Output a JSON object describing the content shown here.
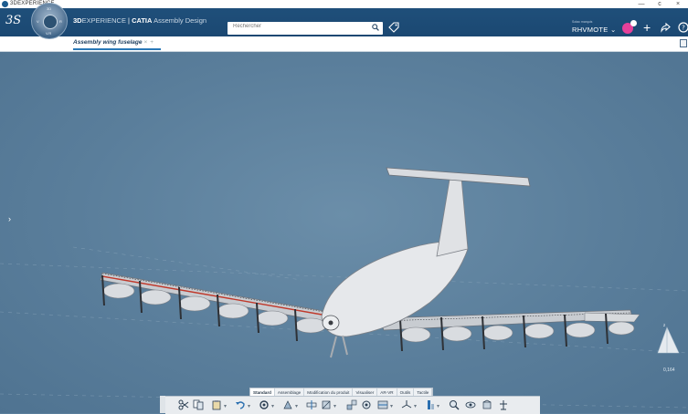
{
  "window": {
    "title": "3DEXPERIENCE",
    "minimize": "—",
    "restore": "c",
    "close": "×"
  },
  "topbar": {
    "logo": "3S",
    "compass_labels": {
      "north": "3D",
      "west": "V",
      "east": "R",
      "south": "V.R"
    },
    "brand_bold": "3D",
    "brand_thin": "EXPERIENCE",
    "brand_sep": " | ",
    "brand_app": "CATIA",
    "brand_role": " Assembly Design",
    "search_placeholder": "Rechercher",
    "user_org": "Sotac marquis",
    "user_name": "RHVMOTE ⌄"
  },
  "tabs": [
    {
      "label": "Assembly wing fuselage",
      "close": "×",
      "add": "+"
    }
  ],
  "viewport": {
    "scale_value": "0,164"
  },
  "action_tabs": [
    "Standard",
    "Assemblage",
    "Modification du produit",
    "Visualiser",
    "AR-VR",
    "Outils",
    "Tactile"
  ],
  "action_bar_icons": [
    "scissors-icon",
    "copy-icon",
    "paste-icon",
    "undo-icon",
    "refresh-icon",
    "fly-icon",
    "measure-icon",
    "pan-icon",
    "assembly-icon",
    "gear-assembly-icon",
    "section-icon",
    "axis-icon",
    "constraint-icon",
    "zoom-icon",
    "look-at-icon",
    "product-icon",
    "snap-icon"
  ],
  "colors": {
    "brand_blue": "#1f4f7a",
    "viewport_bg": "#5b7f9c",
    "badge_pink": "#e6409a"
  }
}
